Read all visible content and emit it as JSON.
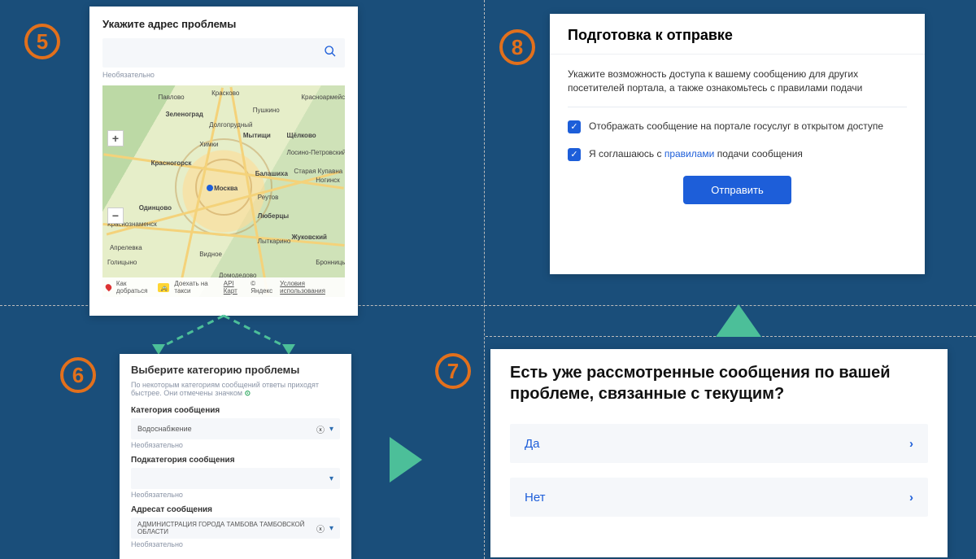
{
  "steps": {
    "s5": "5",
    "s6": "6",
    "s7": "7",
    "s8": "8"
  },
  "step5": {
    "title": "Укажите адрес проблемы",
    "optional": "Необязательно",
    "map_labels": {
      "moscow": "Москва",
      "zelenograd": "Зеленоград",
      "khimki": "Химки",
      "mytishchi": "Мытищи",
      "balashikha": "Балашиха",
      "reutov": "Реутов",
      "lyubertsy": "Люберцы",
      "odintsovo": "Одинцово",
      "krasnogorsk": "Красногорск",
      "vidnoye": "Видное",
      "krasnoznamensk": "Краснознаменск",
      "aprelevka": "Апрелевка",
      "shchelkovo": "Щёлково",
      "pushkino": "Пушкино",
      "zhukovsky": "Жуковский",
      "lytkarino": "Лыткарино",
      "domodedovo": "Домодедово",
      "krasnoarmeysk": "Красноармейск",
      "dolgoprudny": "Долгопрудный",
      "bronnitsy": "Бронницы",
      "noginsk": "Ногинск",
      "losino": "Лосино-Петровский",
      "star_kupavna": "Старая Купавна",
      "golitsyno": "Голицыно",
      "pavlovo": "Павлово",
      "kraskovo": "Красково"
    },
    "footer": {
      "route": "Как добраться",
      "taxi": "Доехать на такси",
      "api": "API Карт",
      "copy": "© Яндекс",
      "terms": "Условия использования"
    }
  },
  "step6": {
    "title": "Выберите категорию проблемы",
    "sub": "По некоторым категориям сообщений ответы приходят быстрее. Они отмечены значком",
    "fields": {
      "cat_label": "Категория сообщения",
      "cat_value": "Водоснабжение",
      "subcat_label": "Подкатегория сообщения",
      "subcat_value": "",
      "addr_label": "Адресат сообщения",
      "addr_value": "АДМИНИСТРАЦИЯ ГОРОДА ТАМБОВА ТАМБОВСКОЙ ОБЛАСТИ",
      "optional": "Необязательно"
    }
  },
  "step7": {
    "question": "Есть уже рассмотренные сообщения по вашей проблеме, связанные с текущим?",
    "yes": "Да",
    "no": "Нет"
  },
  "step8": {
    "title": "Подготовка к отправке",
    "desc": "Укажите возможность доступа к вашему сообщению для других посетителей портала, а также ознакомьтесь с правилами подачи",
    "chk1": "Отображать сообщение на портале госуслуг в открытом доступе",
    "chk2_a": "Я соглашаюсь с ",
    "chk2_link": "правилами",
    "chk2_b": " подачи сообщения",
    "submit": "Отправить"
  }
}
